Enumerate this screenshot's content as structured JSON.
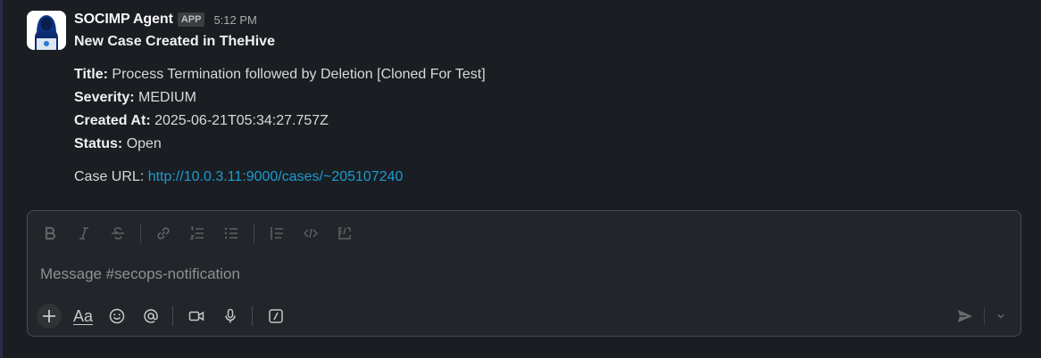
{
  "message": {
    "sender": "SOCIMP Agent",
    "badge": "APP",
    "time": "5:12 PM",
    "title": "New Case Created in TheHive",
    "fields": [
      {
        "label": "Title:",
        "value": "Process Termination followed by Deletion [Cloned For Test]"
      },
      {
        "label": "Severity:",
        "value": "MEDIUM"
      },
      {
        "label": "Created At:",
        "value": "2025-06-21T05:34:27.757Z"
      },
      {
        "label": "Status:",
        "value": "Open"
      }
    ],
    "case_url_label": "Case URL:",
    "case_url": "http://10.0.3.11:9000/cases/~205107240"
  },
  "composer": {
    "placeholder": "Message #secops-notification",
    "aa_label": "Aa",
    "formatting_icons": [
      "bold-icon",
      "italic-icon",
      "strikethrough-icon",
      "link-icon",
      "numbered-list-icon",
      "bulleted-list-icon",
      "blockquote-icon",
      "code-icon",
      "code-block-icon"
    ],
    "action_icons": [
      "plus-icon",
      "formatting-toggle-icon",
      "emoji-icon",
      "mention-icon",
      "video-icon",
      "microphone-icon",
      "slash-command-icon",
      "send-icon",
      "chevron-down-icon"
    ]
  },
  "colors": {
    "background": "#1a1d21",
    "link": "#1d9bd1",
    "composer_border": "#4a4c50"
  }
}
